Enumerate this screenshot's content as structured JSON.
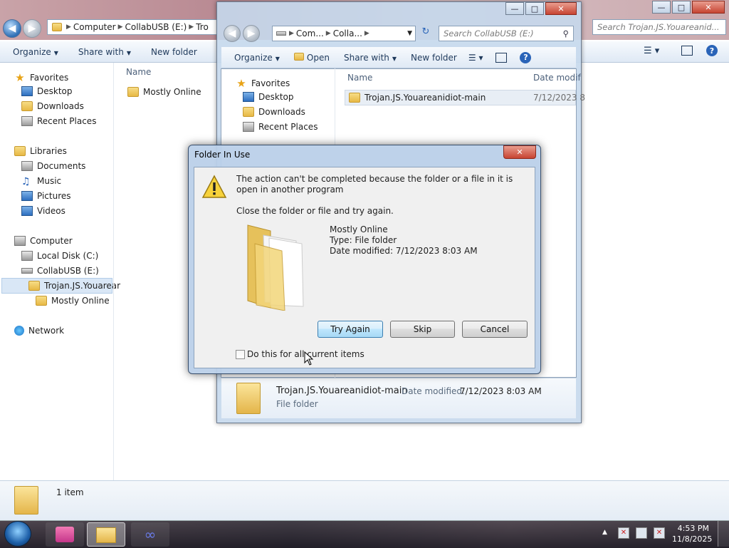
{
  "background_window": {
    "breadcrumb": [
      "Computer",
      "CollabUSB (E:)",
      "Tro"
    ],
    "search_placeholder": "Search Trojan.JS.Youareanid...",
    "toolbar": {
      "organize": "Organize",
      "share_with": "Share with",
      "new_folder": "New folder"
    },
    "nav": {
      "favorites": "Favorites",
      "favorites_items": [
        "Desktop",
        "Downloads",
        "Recent Places"
      ],
      "libraries": "Libraries",
      "libraries_items": [
        "Documents",
        "Music",
        "Pictures",
        "Videos"
      ],
      "computer": "Computer",
      "computer_items": [
        "Local Disk (C:)",
        "CollabUSB (E:)"
      ],
      "selected_folder": "Trojan.JS.Youarear",
      "sub_folder": "Mostly Online",
      "network": "Network"
    },
    "column_name": "Name",
    "files": [
      "Mostly Online"
    ],
    "status": "1 item"
  },
  "front_window": {
    "breadcrumb": [
      "Com...",
      "Colla..."
    ],
    "search_placeholder": "Search CollabUSB (E:)",
    "toolbar": {
      "organize": "Organize",
      "open": "Open",
      "share_with": "Share with",
      "new_folder": "New folder"
    },
    "nav": {
      "favorites": "Favorites",
      "items": [
        "Desktop",
        "Downloads",
        "Recent Places"
      ]
    },
    "columns": {
      "name": "Name",
      "date": "Date modif"
    },
    "row": {
      "name": "Trojan.JS.Youareanidiot-main",
      "date": "7/12/2023 8"
    },
    "details": {
      "name": "Trojan.JS.Youareanidiot-main",
      "date_label": "Date modified:",
      "date": "7/12/2023 8:03 AM",
      "type": "File folder"
    }
  },
  "dialog": {
    "title": "Folder In Use",
    "message": "The action can't be completed because the folder or a file in it is open in another program",
    "instruction": "Close the folder or file and try again.",
    "item_name": "Mostly Online",
    "item_type": "Type: File folder",
    "item_date": "Date modified: 7/12/2023 8:03 AM",
    "buttons": {
      "try_again": "Try Again",
      "skip": "Skip",
      "cancel": "Cancel"
    },
    "checkbox_label": "Do this for all current items",
    "checkbox_checked": false
  },
  "taskbar": {
    "time": "4:53 PM",
    "date": "11/8/2025"
  },
  "colors": {
    "accent": "#1e395b",
    "dialog_frame": "#bad0e9",
    "close_button": "#c74432"
  }
}
